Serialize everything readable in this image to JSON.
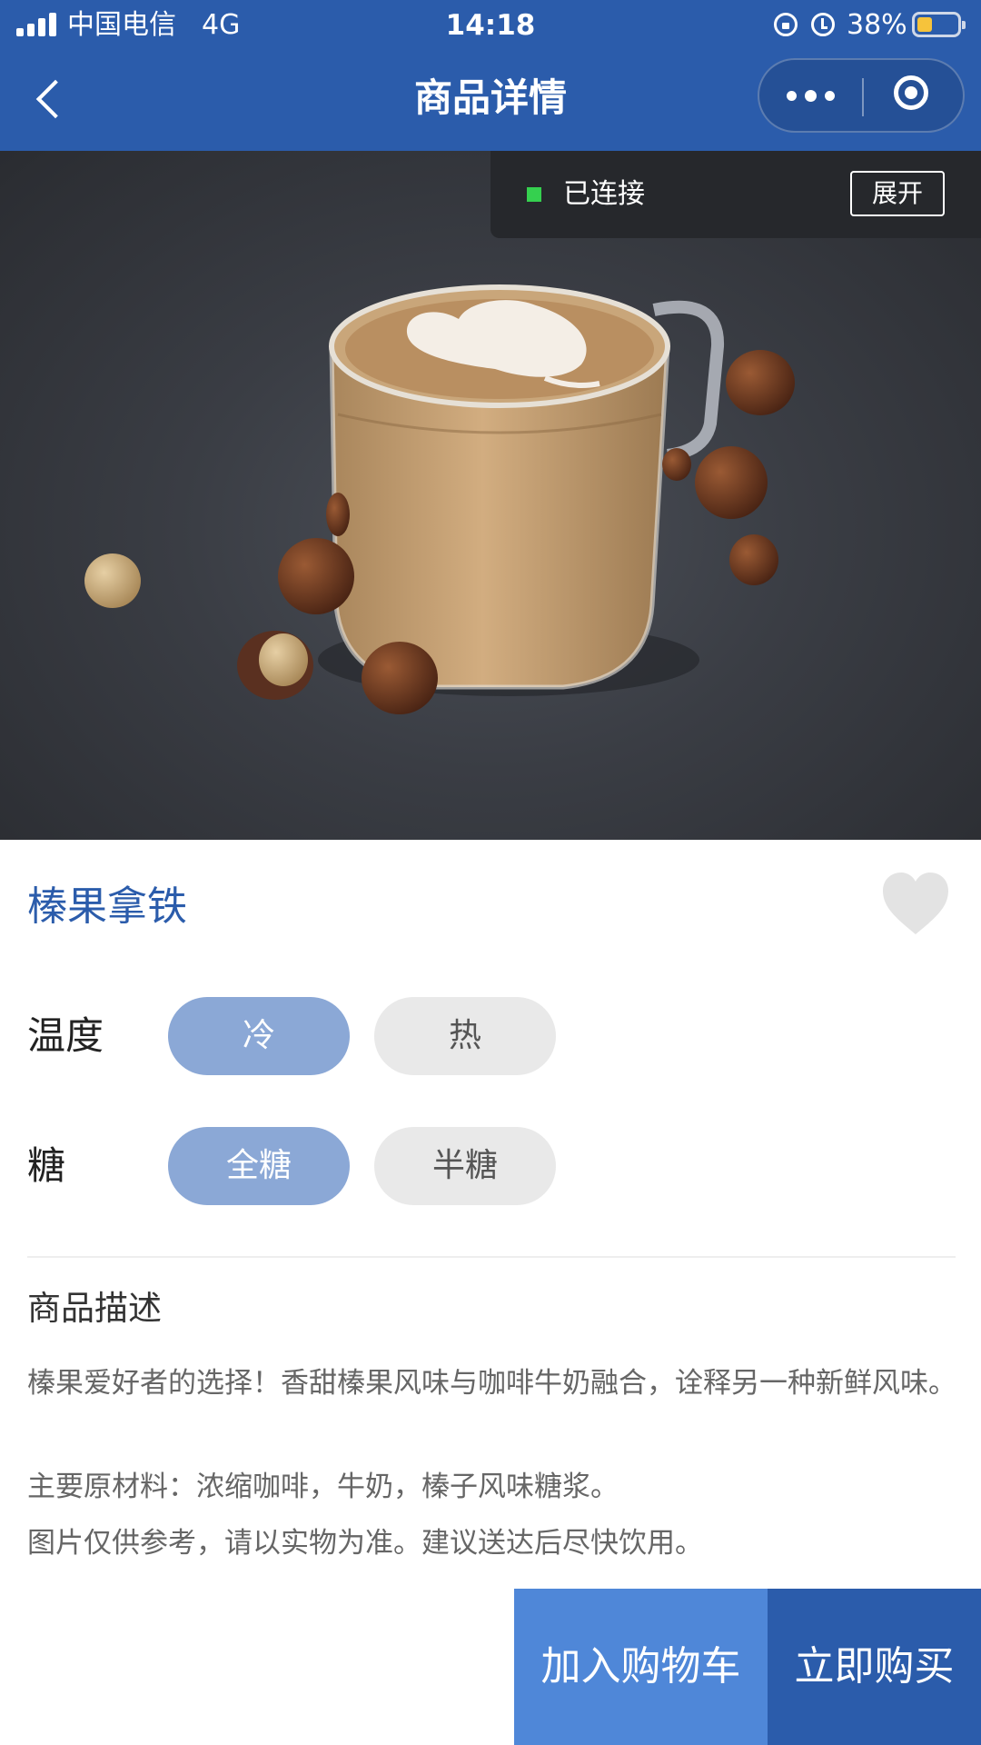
{
  "status_bar": {
    "carrier": "中国电信",
    "network": "4G",
    "time": "14:18",
    "battery_percent": "38%",
    "battery_level": 0.38,
    "icons": [
      "signal-icon",
      "orientation-lock-icon",
      "alarm-icon",
      "battery-icon"
    ]
  },
  "nav": {
    "title": "商品详情",
    "back_icon": "back-arrow-icon",
    "more_icon": "more-dots-icon",
    "close_icon": "close-target-icon"
  },
  "connection": {
    "status": "已连接",
    "status_color": "#35d04f",
    "expand_label": "展开"
  },
  "product": {
    "name": "榛果拿铁",
    "favorite_icon": "heart-icon",
    "options": [
      {
        "label": "温度",
        "choices": [
          "冷",
          "热"
        ],
        "selected": "冷"
      },
      {
        "label": "糖",
        "choices": [
          "全糖",
          "半糖"
        ],
        "selected": "全糖"
      }
    ],
    "description_title": "商品描述",
    "description": [
      "榛果爱好者的选择！香甜榛果风味与咖啡牛奶融合，诠释另一种新鲜风味。",
      "主要原材料：浓缩咖啡，牛奶，榛子风味糖浆。",
      "图片仅供参考，请以实物为准。建议送达后尽快饮用。"
    ]
  },
  "actions": {
    "add_to_cart": "加入购物车",
    "buy_now": "立即购买"
  },
  "colors": {
    "brand": "#2b5cab",
    "cart_button": "#4f87d8",
    "selected_pill": "#8ba8d6",
    "unselected_pill": "#e9e9e9"
  }
}
